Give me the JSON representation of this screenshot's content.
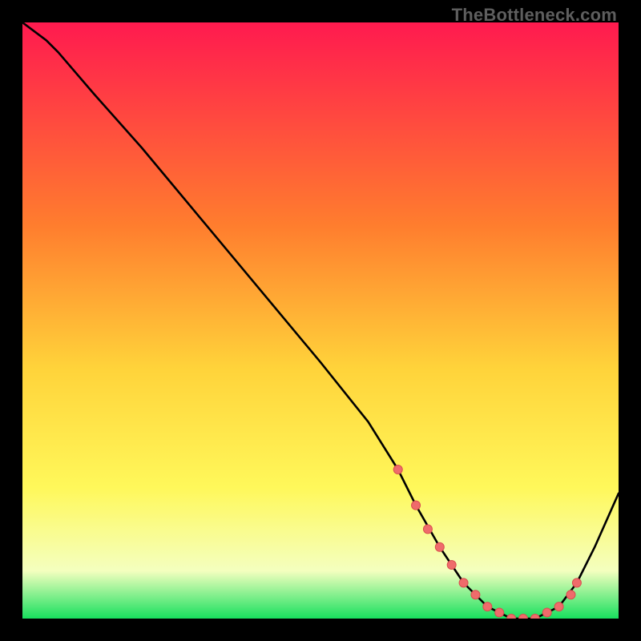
{
  "watermark": "TheBottleneck.com",
  "colors": {
    "gradient_top": "#ff1a4f",
    "gradient_mid1": "#ff7d2e",
    "gradient_mid2": "#ffd33a",
    "gradient_mid3": "#fff85a",
    "gradient_pale": "#f4ffbf",
    "gradient_bottom": "#18e05e",
    "curve": "#000000",
    "marker_fill": "#ef6b6b",
    "marker_stroke": "#d94f4f"
  },
  "chart_data": {
    "type": "line",
    "title": "",
    "xlabel": "",
    "ylabel": "",
    "xlim": [
      0,
      100
    ],
    "ylim": [
      0,
      100
    ],
    "curve": {
      "name": "bottleneck-curve",
      "x": [
        0,
        4,
        6,
        12,
        20,
        30,
        40,
        50,
        58,
        63,
        66,
        70,
        74,
        78,
        82,
        86,
        90,
        93,
        96,
        100
      ],
      "values": [
        100,
        97,
        95,
        88,
        79,
        67,
        55,
        43,
        33,
        25,
        19,
        12,
        6,
        2,
        0,
        0,
        2,
        6,
        12,
        21
      ]
    },
    "markers": {
      "name": "highlight-points",
      "x": [
        63,
        66,
        68,
        70,
        72,
        74,
        76,
        78,
        80,
        82,
        84,
        86,
        88,
        90,
        92,
        93
      ],
      "values": [
        25,
        19,
        15,
        12,
        9,
        6,
        4,
        2,
        1,
        0,
        0,
        0,
        1,
        2,
        4,
        6
      ]
    }
  }
}
